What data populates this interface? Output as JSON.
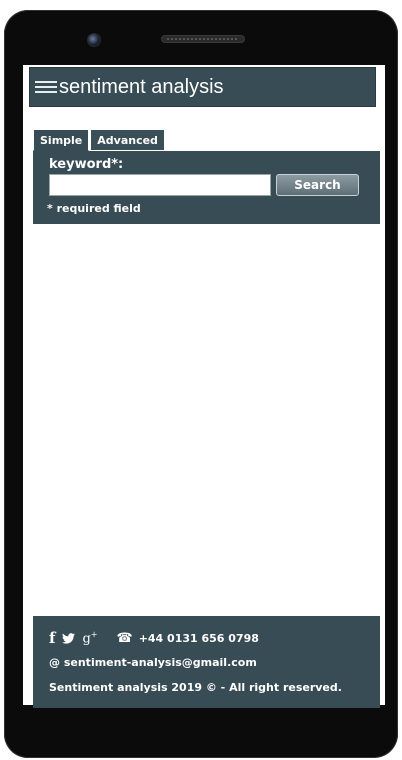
{
  "app": {
    "title": "sentiment analysis"
  },
  "tabs": [
    {
      "label": "Simple",
      "active": true
    },
    {
      "label": "Advanced",
      "active": false
    }
  ],
  "search": {
    "keyword_label": "keyword*:",
    "keyword_value": "",
    "button_label": "Search",
    "required_note": "* required field"
  },
  "footer": {
    "phone": "+44 0131 656 0798",
    "email_prefix": "@",
    "email": "sentiment-analysis@gmail.com",
    "copyright": "Sentiment analysis 2019 © - All right reserved.",
    "social_icons": [
      "facebook-icon",
      "twitter-icon",
      "google-plus-icon"
    ],
    "phone_icon": "telephone-icon"
  },
  "colors": {
    "panel": "#384c55",
    "device": "#0b0b0b",
    "text_on_panel": "#ffffff"
  }
}
